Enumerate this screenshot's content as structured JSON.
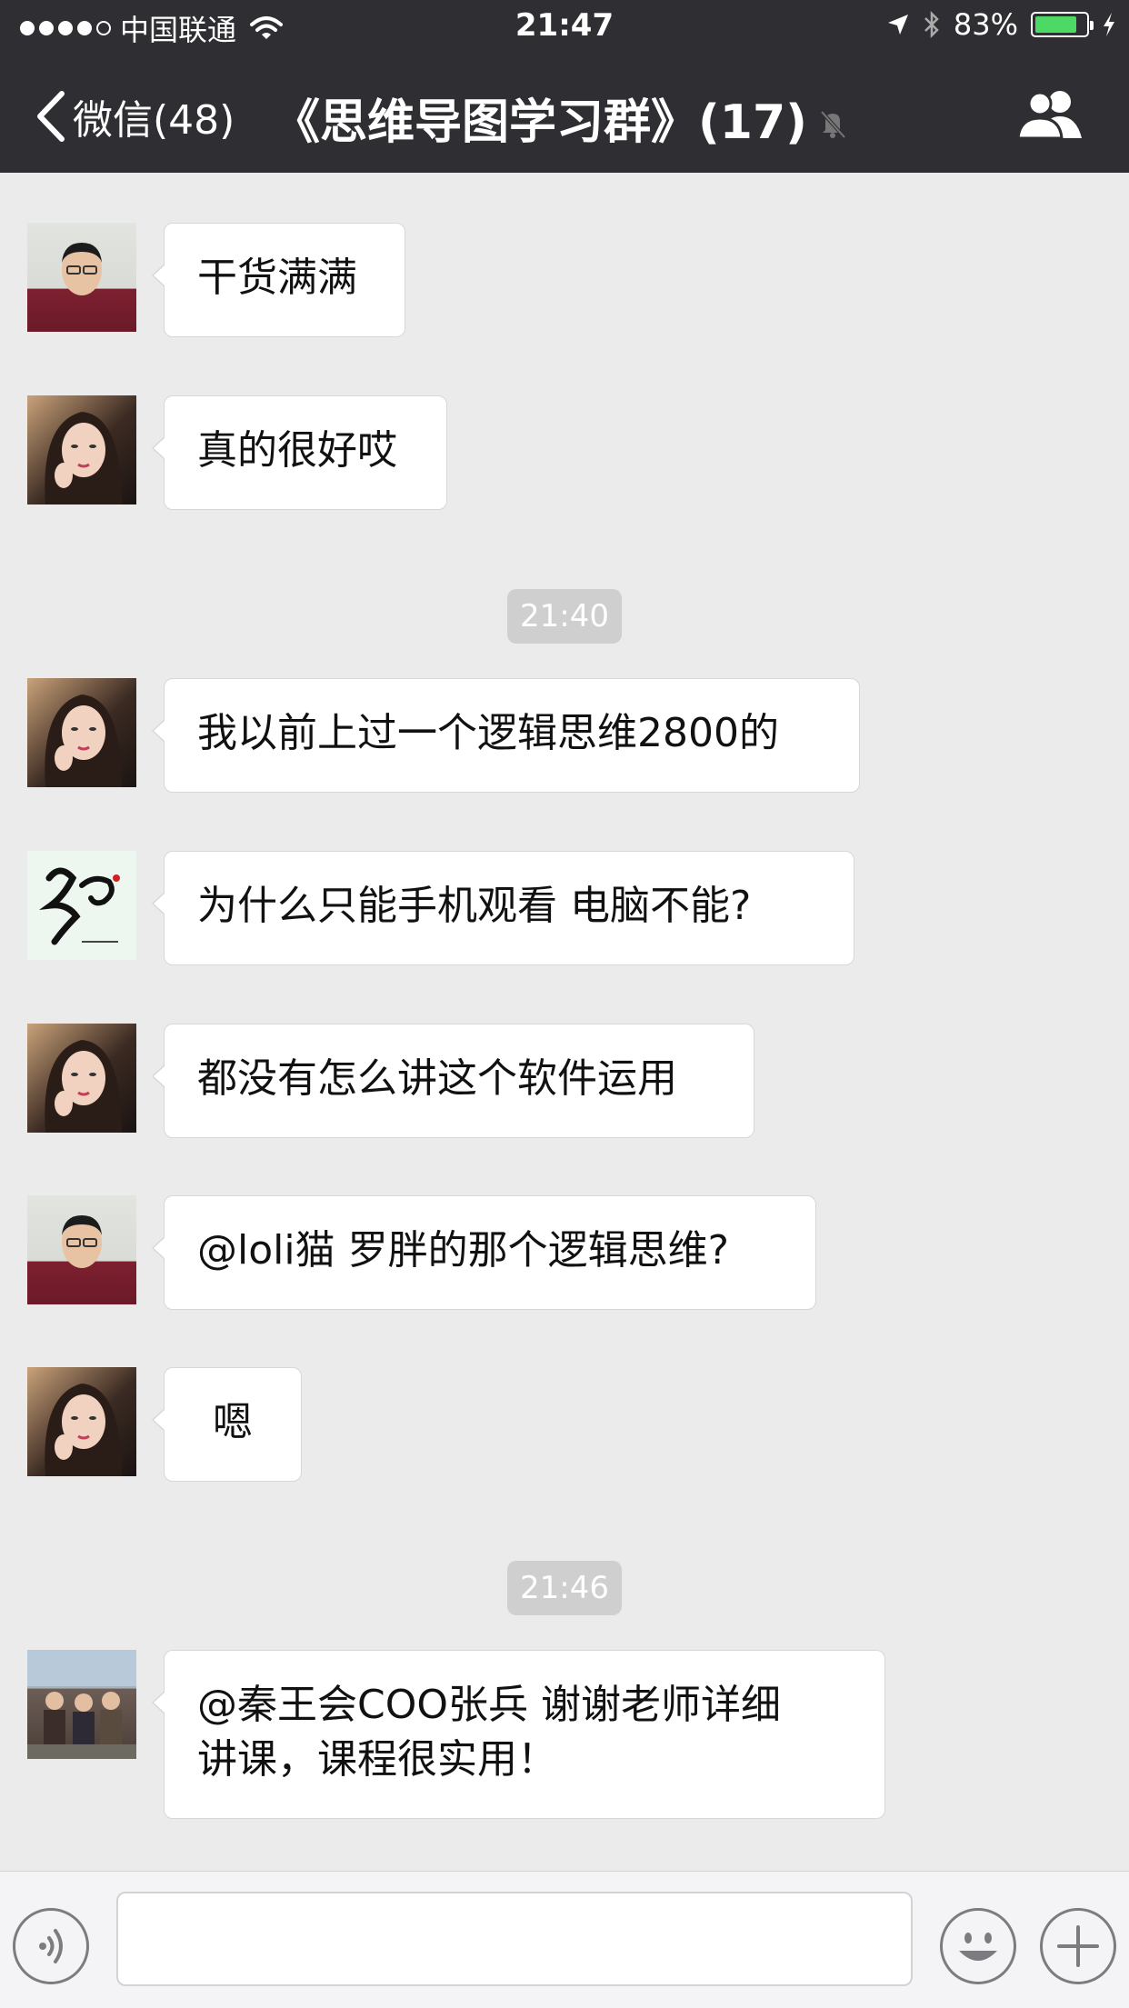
{
  "status_bar": {
    "carrier": "中国联通",
    "time": "21:47",
    "battery": "83%",
    "battery_level": 0.83,
    "signal_bars": 4
  },
  "nav": {
    "back_label": "微信(48)",
    "title": "《思维导图学习群》(17)",
    "muted": true
  },
  "messages": [
    {
      "type": "text",
      "avatar": "man-red-sweater",
      "text": "干货满满"
    },
    {
      "type": "text",
      "avatar": "woman",
      "text": "真的很好哎"
    },
    {
      "type": "time",
      "text": "21:40"
    },
    {
      "type": "text",
      "avatar": "woman",
      "text": "我以前上过一个逻辑思维2800的"
    },
    {
      "type": "text",
      "avatar": "calligraphy",
      "text": "为什么只能手机观看 电脑不能?"
    },
    {
      "type": "text",
      "avatar": "woman",
      "text": "都没有怎么讲这个软件运用"
    },
    {
      "type": "text",
      "avatar": "man-red-sweater",
      "text": "@loli猫 罗胖的那个逻辑思维?"
    },
    {
      "type": "text",
      "avatar": "woman",
      "text": "嗯"
    },
    {
      "type": "time",
      "text": "21:46"
    },
    {
      "type": "text",
      "avatar": "group-photo",
      "lines": [
        "@秦王会COO张兵 谢谢老师详细",
        "讲课，课程很实用！"
      ]
    }
  ],
  "input": {
    "placeholder": ""
  },
  "icons": {
    "back": "chevron-left-icon",
    "mute": "bell-slash-icon",
    "members": "people-icon",
    "voice": "voice-icon",
    "emoji": "smiley-icon",
    "plus": "plus-icon"
  },
  "colors": {
    "header_bg": "#2f2f33",
    "chat_bg": "#ebebeb",
    "bubble_bg": "#ffffff",
    "timestamp_bg": "#cfcfcf",
    "battery_green": "#4cd964"
  }
}
